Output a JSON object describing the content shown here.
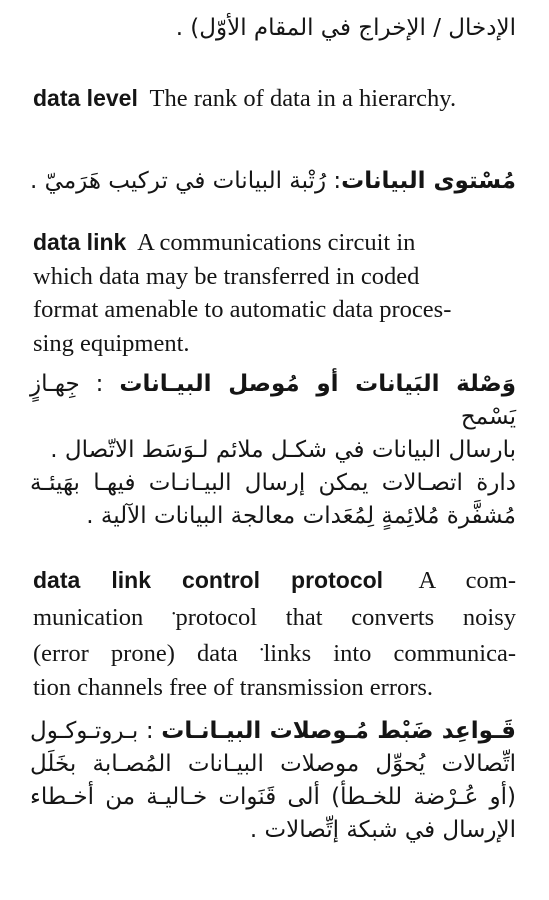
{
  "page": {
    "top_continuation": {
      "arabic_text": "الإدخال / الإخراج في المقام الأوّل) ."
    },
    "entries": [
      {
        "term": "data level",
        "definition": "The rank of data in a hierarchy.",
        "arabic_term": "مُسْتوى البيانات",
        "arabic_definition": ": رُتْبة البيانات في تركيب هَرَميّ ."
      },
      {
        "term": "data link",
        "definition": "A communications circuit in which data may be transferred in coded format amenable to automatic data processing equipment.",
        "definition_lines": [
          "A communications circuit in",
          "which data may be transferred in coded",
          "format amenable to automatic data proces-",
          "sing equipment."
        ],
        "arabic_term": "وَصْلة البَيانات أو مُوصل البيـانات",
        "arabic_definition_lines": [
          ": جِهـازٍ يَسْمح",
          "بارسال البيانات في شكـل ملائم لـوَسَط الاتّصال .",
          "دارة اتصـالات يمكن إرسال البيـانـات فيهـا بهَيئـة",
          "مُشفَّرة مُلائِمةٍ لِمُعَدات معالجة البيانات الآلية ."
        ]
      },
      {
        "term": "data link control protocol",
        "definition": "A communication *protocol that converts noisy (error prone) data *links into communication channels free of transmission errors.",
        "definition_lines": [
          "A com-",
          "munication",
          "protocol that converts noisy",
          "(error prone) data",
          "links into communica-",
          "tion channels free of transmission errors."
        ],
        "cross_reference_mark": "•",
        "arabic_term": "قَـواعِد ضَبْط مُـوصلات البيـانـات",
        "arabic_definition_lines": [
          ": بـروتـوكـول",
          "اتِّصالات يُحوِّل موصلات البيـانات المُصـابة بخَلَل",
          "(أو عُـرْضة للخـطأ) ألى قَنَوات خـاليـة من أخـطاء",
          "الإرسال في شبكة إتِّصالات ."
        ]
      }
    ]
  }
}
